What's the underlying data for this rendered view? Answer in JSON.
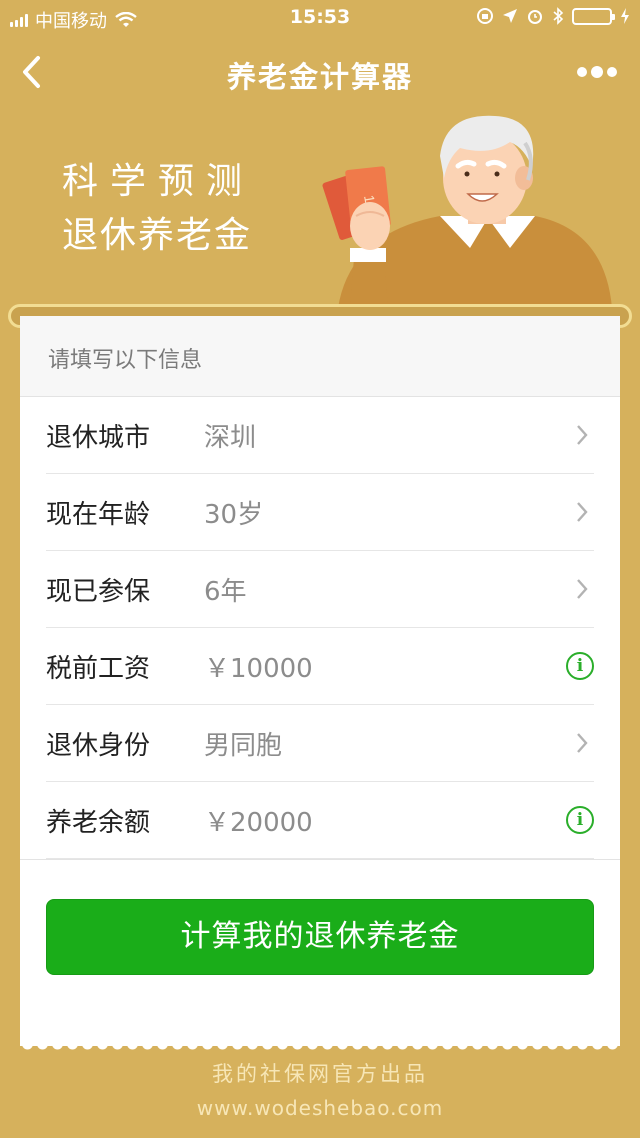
{
  "status_bar": {
    "carrier": "中国移动",
    "time": "15:53",
    "icons": [
      "signal-icon",
      "wifi-icon",
      "rotation-lock-icon",
      "location-icon",
      "alarm-icon",
      "bluetooth-icon",
      "battery-icon",
      "charging-icon"
    ]
  },
  "nav": {
    "title": "养老金计算器",
    "back_icon": "back-chevron-icon",
    "more_icon": "more-dots-icon"
  },
  "hero": {
    "line1": "科学预测",
    "line2": "退休养老金"
  },
  "form": {
    "header": "请填写以下信息",
    "rows": [
      {
        "label": "退休城市",
        "value": "深圳",
        "trailing": "chevron"
      },
      {
        "label": "现在年龄",
        "value": "30岁",
        "trailing": "chevron"
      },
      {
        "label": "现已参保",
        "value": "6年",
        "trailing": "chevron"
      },
      {
        "label": "税前工资",
        "value": "￥10000",
        "trailing": "info"
      },
      {
        "label": "退休身份",
        "value": "男同胞",
        "trailing": "chevron"
      },
      {
        "label": "养老余额",
        "value": "￥20000",
        "trailing": "info"
      }
    ],
    "info_glyph": "i",
    "submit_label": "计算我的退休养老金"
  },
  "footer": {
    "line1": "我的社保网官方出品",
    "line2": "www.wodeshebao.com"
  },
  "colors": {
    "background": "#d6b15c",
    "primary_button": "#1aad19",
    "info_icon": "#2aae2a"
  }
}
